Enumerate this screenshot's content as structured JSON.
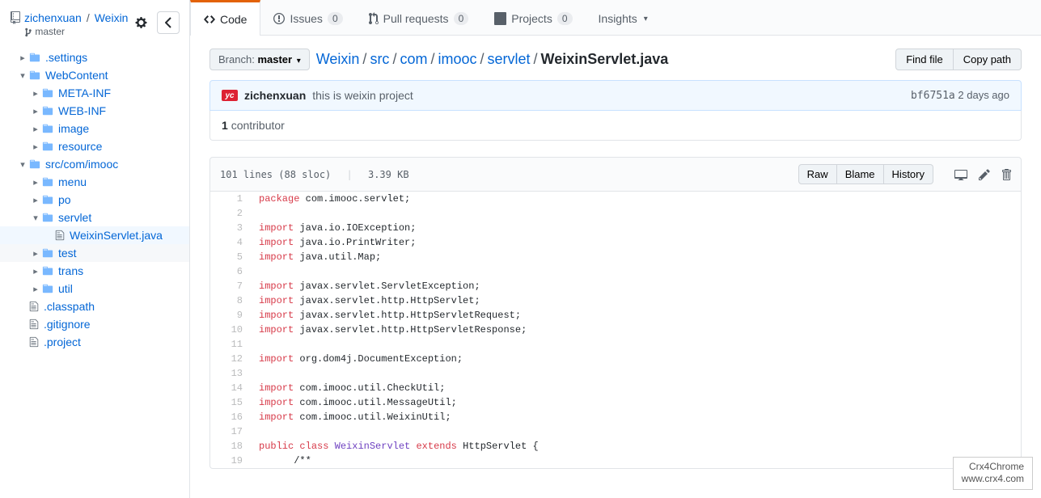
{
  "repo": {
    "owner": "zichenxuan",
    "name": "Weixin",
    "branch": "master"
  },
  "sidebar": {
    "items": [
      {
        "label": ".settings",
        "type": "folder",
        "level": 0,
        "chev": "closed"
      },
      {
        "label": "WebContent",
        "type": "folder",
        "level": 0,
        "chev": "open"
      },
      {
        "label": "META-INF",
        "type": "folder",
        "level": 1,
        "chev": "closed"
      },
      {
        "label": "WEB-INF",
        "type": "folder",
        "level": 1,
        "chev": "closed"
      },
      {
        "label": "image",
        "type": "folder",
        "level": 1,
        "chev": "closed"
      },
      {
        "label": "resource",
        "type": "folder",
        "level": 1,
        "chev": "closed"
      },
      {
        "label": "src/com/imooc",
        "type": "folder",
        "level": 0,
        "chev": "open"
      },
      {
        "label": "menu",
        "type": "folder",
        "level": 1,
        "chev": "closed"
      },
      {
        "label": "po",
        "type": "folder",
        "level": 1,
        "chev": "closed"
      },
      {
        "label": "servlet",
        "type": "folder",
        "level": 1,
        "chev": "open"
      },
      {
        "label": "WeixinServlet.java",
        "type": "file",
        "level": 2,
        "chev": "none",
        "selected": true
      },
      {
        "label": "test",
        "type": "folder",
        "level": 1,
        "chev": "closed",
        "highlight": true
      },
      {
        "label": "trans",
        "type": "folder",
        "level": 1,
        "chev": "closed"
      },
      {
        "label": "util",
        "type": "folder",
        "level": 1,
        "chev": "closed"
      },
      {
        "label": ".classpath",
        "type": "file",
        "level": 0,
        "chev": "none"
      },
      {
        "label": ".gitignore",
        "type": "file",
        "level": 0,
        "chev": "none"
      },
      {
        "label": ".project",
        "type": "file",
        "level": 0,
        "chev": "none"
      }
    ]
  },
  "tabs": {
    "code": "Code",
    "issues": "Issues",
    "issues_count": "0",
    "pulls": "Pull requests",
    "pulls_count": "0",
    "projects": "Projects",
    "projects_count": "0",
    "insights": "Insights"
  },
  "breadcrumb": {
    "branch_label": "Branch:",
    "branch_name": "master",
    "parts": [
      "Weixin",
      "src",
      "com",
      "imooc",
      "servlet"
    ],
    "file": "WeixinServlet.java"
  },
  "buttons": {
    "find_file": "Find file",
    "copy_path": "Copy path",
    "raw": "Raw",
    "blame": "Blame",
    "history": "History"
  },
  "commit": {
    "author": "zichenxuan",
    "message": "this is weixin project",
    "sha": "bf6751a",
    "age": "2 days ago"
  },
  "contributors": {
    "count": "1",
    "label": "contributor"
  },
  "file_stats": {
    "lines": "101 lines (88 sloc)",
    "size": "3.39 KB"
  },
  "code": [
    {
      "n": 1,
      "html": "<span class='kw'>package</span> com.imooc.servlet;"
    },
    {
      "n": 2,
      "html": ""
    },
    {
      "n": 3,
      "html": "<span class='kw'>import</span> java.io.IOException;"
    },
    {
      "n": 4,
      "html": "<span class='kw'>import</span> java.io.PrintWriter;"
    },
    {
      "n": 5,
      "html": "<span class='kw'>import</span> java.util.Map;"
    },
    {
      "n": 6,
      "html": ""
    },
    {
      "n": 7,
      "html": "<span class='kw'>import</span> javax.servlet.ServletException;"
    },
    {
      "n": 8,
      "html": "<span class='kw'>import</span> javax.servlet.http.HttpServlet;"
    },
    {
      "n": 9,
      "html": "<span class='kw'>import</span> javax.servlet.http.HttpServletRequest;"
    },
    {
      "n": 10,
      "html": "<span class='kw'>import</span> javax.servlet.http.HttpServletResponse;"
    },
    {
      "n": 11,
      "html": ""
    },
    {
      "n": 12,
      "html": "<span class='kw'>import</span> org.dom4j.DocumentException;"
    },
    {
      "n": 13,
      "html": ""
    },
    {
      "n": 14,
      "html": "<span class='kw'>import</span> com.imooc.util.CheckUtil;"
    },
    {
      "n": 15,
      "html": "<span class='kw'>import</span> com.imooc.util.MessageUtil;"
    },
    {
      "n": 16,
      "html": "<span class='kw'>import</span> com.imooc.util.WeixinUtil;"
    },
    {
      "n": 17,
      "html": ""
    },
    {
      "n": 18,
      "html": "<span class='kw'>public</span> <span class='kw'>class</span> <span class='cls-def'>WeixinServlet</span> <span class='kw'>extends</span> HttpServlet {"
    },
    {
      "n": 19,
      "html": "      /**"
    }
  ],
  "watermark": {
    "line1": "Crx4Chrome",
    "line2": "www.crx4.com"
  }
}
